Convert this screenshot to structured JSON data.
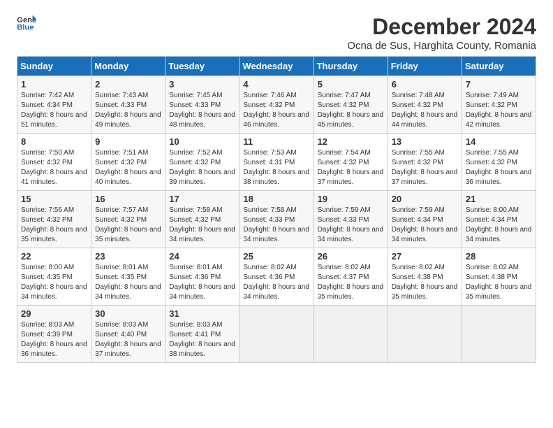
{
  "header": {
    "logo_general": "General",
    "logo_blue": "Blue",
    "title": "December 2024",
    "subtitle": "Ocna de Sus, Harghita County, Romania"
  },
  "weekdays": [
    "Sunday",
    "Monday",
    "Tuesday",
    "Wednesday",
    "Thursday",
    "Friday",
    "Saturday"
  ],
  "weeks": [
    [
      {
        "day": "1",
        "sunrise": "7:42 AM",
        "sunset": "4:34 PM",
        "daylight": "8 hours and 51 minutes."
      },
      {
        "day": "2",
        "sunrise": "7:43 AM",
        "sunset": "4:33 PM",
        "daylight": "8 hours and 49 minutes."
      },
      {
        "day": "3",
        "sunrise": "7:45 AM",
        "sunset": "4:33 PM",
        "daylight": "8 hours and 48 minutes."
      },
      {
        "day": "4",
        "sunrise": "7:46 AM",
        "sunset": "4:32 PM",
        "daylight": "8 hours and 46 minutes."
      },
      {
        "day": "5",
        "sunrise": "7:47 AM",
        "sunset": "4:32 PM",
        "daylight": "8 hours and 45 minutes."
      },
      {
        "day": "6",
        "sunrise": "7:48 AM",
        "sunset": "4:32 PM",
        "daylight": "8 hours and 44 minutes."
      },
      {
        "day": "7",
        "sunrise": "7:49 AM",
        "sunset": "4:32 PM",
        "daylight": "8 hours and 42 minutes."
      }
    ],
    [
      {
        "day": "8",
        "sunrise": "7:50 AM",
        "sunset": "4:32 PM",
        "daylight": "8 hours and 41 minutes."
      },
      {
        "day": "9",
        "sunrise": "7:51 AM",
        "sunset": "4:32 PM",
        "daylight": "8 hours and 40 minutes."
      },
      {
        "day": "10",
        "sunrise": "7:52 AM",
        "sunset": "4:32 PM",
        "daylight": "8 hours and 39 minutes."
      },
      {
        "day": "11",
        "sunrise": "7:53 AM",
        "sunset": "4:31 PM",
        "daylight": "8 hours and 38 minutes."
      },
      {
        "day": "12",
        "sunrise": "7:54 AM",
        "sunset": "4:32 PM",
        "daylight": "8 hours and 37 minutes."
      },
      {
        "day": "13",
        "sunrise": "7:55 AM",
        "sunset": "4:32 PM",
        "daylight": "8 hours and 37 minutes."
      },
      {
        "day": "14",
        "sunrise": "7:55 AM",
        "sunset": "4:32 PM",
        "daylight": "8 hours and 36 minutes."
      }
    ],
    [
      {
        "day": "15",
        "sunrise": "7:56 AM",
        "sunset": "4:32 PM",
        "daylight": "8 hours and 35 minutes."
      },
      {
        "day": "16",
        "sunrise": "7:57 AM",
        "sunset": "4:32 PM",
        "daylight": "8 hours and 35 minutes."
      },
      {
        "day": "17",
        "sunrise": "7:58 AM",
        "sunset": "4:32 PM",
        "daylight": "8 hours and 34 minutes."
      },
      {
        "day": "18",
        "sunrise": "7:58 AM",
        "sunset": "4:33 PM",
        "daylight": "8 hours and 34 minutes."
      },
      {
        "day": "19",
        "sunrise": "7:59 AM",
        "sunset": "4:33 PM",
        "daylight": "8 hours and 34 minutes."
      },
      {
        "day": "20",
        "sunrise": "7:59 AM",
        "sunset": "4:34 PM",
        "daylight": "8 hours and 34 minutes."
      },
      {
        "day": "21",
        "sunrise": "8:00 AM",
        "sunset": "4:34 PM",
        "daylight": "8 hours and 34 minutes."
      }
    ],
    [
      {
        "day": "22",
        "sunrise": "8:00 AM",
        "sunset": "4:35 PM",
        "daylight": "8 hours and 34 minutes."
      },
      {
        "day": "23",
        "sunrise": "8:01 AM",
        "sunset": "4:35 PM",
        "daylight": "8 hours and 34 minutes."
      },
      {
        "day": "24",
        "sunrise": "8:01 AM",
        "sunset": "4:36 PM",
        "daylight": "8 hours and 34 minutes."
      },
      {
        "day": "25",
        "sunrise": "8:02 AM",
        "sunset": "4:36 PM",
        "daylight": "8 hours and 34 minutes."
      },
      {
        "day": "26",
        "sunrise": "8:02 AM",
        "sunset": "4:37 PM",
        "daylight": "8 hours and 35 minutes."
      },
      {
        "day": "27",
        "sunrise": "8:02 AM",
        "sunset": "4:38 PM",
        "daylight": "8 hours and 35 minutes."
      },
      {
        "day": "28",
        "sunrise": "8:02 AM",
        "sunset": "4:38 PM",
        "daylight": "8 hours and 35 minutes."
      }
    ],
    [
      {
        "day": "29",
        "sunrise": "8:03 AM",
        "sunset": "4:39 PM",
        "daylight": "8 hours and 36 minutes."
      },
      {
        "day": "30",
        "sunrise": "8:03 AM",
        "sunset": "4:40 PM",
        "daylight": "8 hours and 37 minutes."
      },
      {
        "day": "31",
        "sunrise": "8:03 AM",
        "sunset": "4:41 PM",
        "daylight": "8 hours and 38 minutes."
      },
      null,
      null,
      null,
      null
    ]
  ]
}
